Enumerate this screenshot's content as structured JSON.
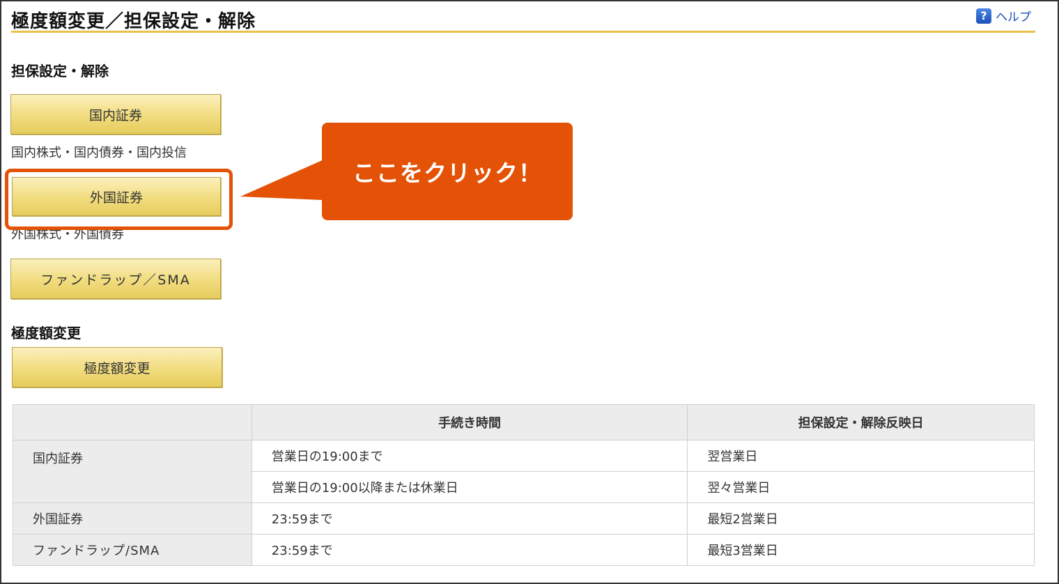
{
  "header": {
    "title": "極度額変更／担保設定・解除",
    "help_label": "ヘルプ",
    "help_icon": "question-icon"
  },
  "collateral_section": {
    "heading": "担保設定・解除",
    "domestic_button": "国内証券",
    "domestic_caption": "国内株式・国内債券・国内投信",
    "foreign_button": "外国証券",
    "foreign_caption": "外国株式・外国債券",
    "fundwrap_button": "ファンドラップ／SMA"
  },
  "limit_section": {
    "heading": "極度額変更",
    "button": "極度額変更"
  },
  "callout": {
    "text": "ここをクリック！",
    "color": "#e35206"
  },
  "table": {
    "headers": [
      "",
      "手続き時間",
      "担保設定・解除反映日"
    ],
    "rows": [
      {
        "label": "国内証券",
        "time": "営業日の19:00まで",
        "date": "翌営業日"
      },
      {
        "label": "",
        "time": "営業日の19:00以降または休業日",
        "date": "翌々営業日"
      },
      {
        "label": "外国証券",
        "time": "23:59まで",
        "date": "最短2営業日"
      },
      {
        "label": "ファンドラップ/SMA",
        "time": "23:59まで",
        "date": "最短3営業日"
      }
    ]
  },
  "colors": {
    "accent_gold": "#e8c04a",
    "highlight": "#e35206",
    "link": "#1a4fb8"
  }
}
